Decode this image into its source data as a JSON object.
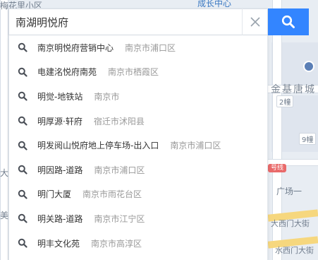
{
  "search": {
    "query": "南湖明悦府",
    "clear_icon": "close-icon",
    "search_icon": "search-icon"
  },
  "suggestions": [
    {
      "name": "南京明悦府营销中心",
      "area": "南京市浦口区"
    },
    {
      "name": "电建洺悦府南苑",
      "area": "南京市栖霞区"
    },
    {
      "name": "明觉-地铁站",
      "area": "南京市"
    },
    {
      "name": "明厚源·轩府",
      "area": "宿迁市沭阳县"
    },
    {
      "name": "明发阅山悦府地上停车场-出入口",
      "area": "南京市浦口区"
    },
    {
      "name": "明因路-道路",
      "area": "南京市浦口区"
    },
    {
      "name": "明门大厦",
      "area": "南京市雨花台区"
    },
    {
      "name": "明关路-道路",
      "area": "南京市江宁区"
    },
    {
      "name": "明丰文化苑",
      "area": "南京市高淳区"
    }
  ],
  "map": {
    "labels": {
      "top_center": "成长中心",
      "top_left": "梅花里小区",
      "jinji": "金基唐城",
      "road_2": "2幢",
      "road_9": "9幢",
      "road_badge": "号线",
      "guangchang": "广场一",
      "street1": "大西门大街",
      "street2": "水西门大街",
      "left_da": "大",
      "left_mei": "美"
    },
    "colors": {
      "accent": "#3385ff",
      "road_yellow": "#f6d77e"
    }
  }
}
